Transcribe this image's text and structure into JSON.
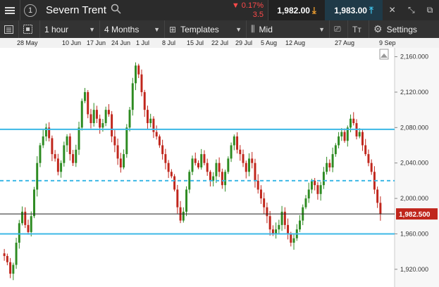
{
  "topbar": {
    "instrument_index": "1",
    "instrument_name": "Severn Trent",
    "change_pct": "▼ 0.17%",
    "change_abs": "3.5",
    "sell_price": "1,982.00",
    "buy_price": "1,983.00"
  },
  "toolbar": {
    "interval": "1 hour",
    "range": "4 Months",
    "templates": "Templates",
    "price_type": "Mid",
    "settings": "Settings"
  },
  "date_axis": [
    "28 May",
    "10 Jun",
    "17 Jun",
    "24 Jun",
    "1 Jul",
    "8 Jul",
    "15 Jul",
    "22 Jul",
    "29 Jul",
    "5 Aug",
    "12 Aug",
    "27 Aug",
    "9 Sep"
  ],
  "chart_data": {
    "type": "candlestick",
    "y_ticks": [
      "2,160.000",
      "2,120.000",
      "2,080.000",
      "2,040.000",
      "2,000.000",
      "1,960.000",
      "1,920.000"
    ],
    "ylim": [
      1900,
      2170
    ],
    "last_price": "1,982.500",
    "last_price_value": 1982.5,
    "horizontal_lines": [
      {
        "value": 2078,
        "style": "solid",
        "color": "#3cb8e6"
      },
      {
        "value": 2020,
        "style": "dashed",
        "color": "#3cb8e6"
      },
      {
        "value": 1960,
        "style": "solid",
        "color": "#3cb8e6"
      }
    ],
    "colors": {
      "up": "#2e8b22",
      "down": "#c0261c"
    },
    "series": [
      1935,
      1928,
      1915,
      1925,
      1950,
      1972,
      1985,
      1970,
      1962,
      1980,
      2010,
      2040,
      2060,
      2070,
      2080,
      2068,
      2050,
      2045,
      2030,
      2040,
      2060,
      2070,
      2050,
      2040,
      2055,
      2080,
      2110,
      2120,
      2095,
      2085,
      2100,
      2090,
      2080,
      2085,
      2100,
      2095,
      2070,
      2060,
      2045,
      2035,
      2050,
      2080,
      2100,
      2130,
      2150,
      2140,
      2120,
      2100,
      2085,
      2090,
      2075,
      2070,
      2060,
      2050,
      2040,
      2030,
      2025,
      2010,
      1990,
      1975,
      1985,
      2010,
      2030,
      2045,
      2040,
      2035,
      2050,
      2040,
      2030,
      2020,
      2025,
      2040,
      2030,
      2015,
      2030,
      2045,
      2060,
      2070,
      2055,
      2050,
      2040,
      2030,
      2045,
      2040,
      2020,
      2010,
      2000,
      1990,
      1980,
      1965,
      1960,
      1965,
      1970,
      1985,
      1970,
      1960,
      1950,
      1955,
      1965,
      1975,
      1990,
      2000,
      2010,
      2020,
      2015,
      2005,
      2015,
      2030,
      2040,
      2035,
      2050,
      2060,
      2070,
      2075,
      2065,
      2080,
      2090,
      2085,
      2070,
      2075,
      2060,
      2050,
      2040,
      2030,
      2010,
      1995,
      1982.5
    ]
  }
}
